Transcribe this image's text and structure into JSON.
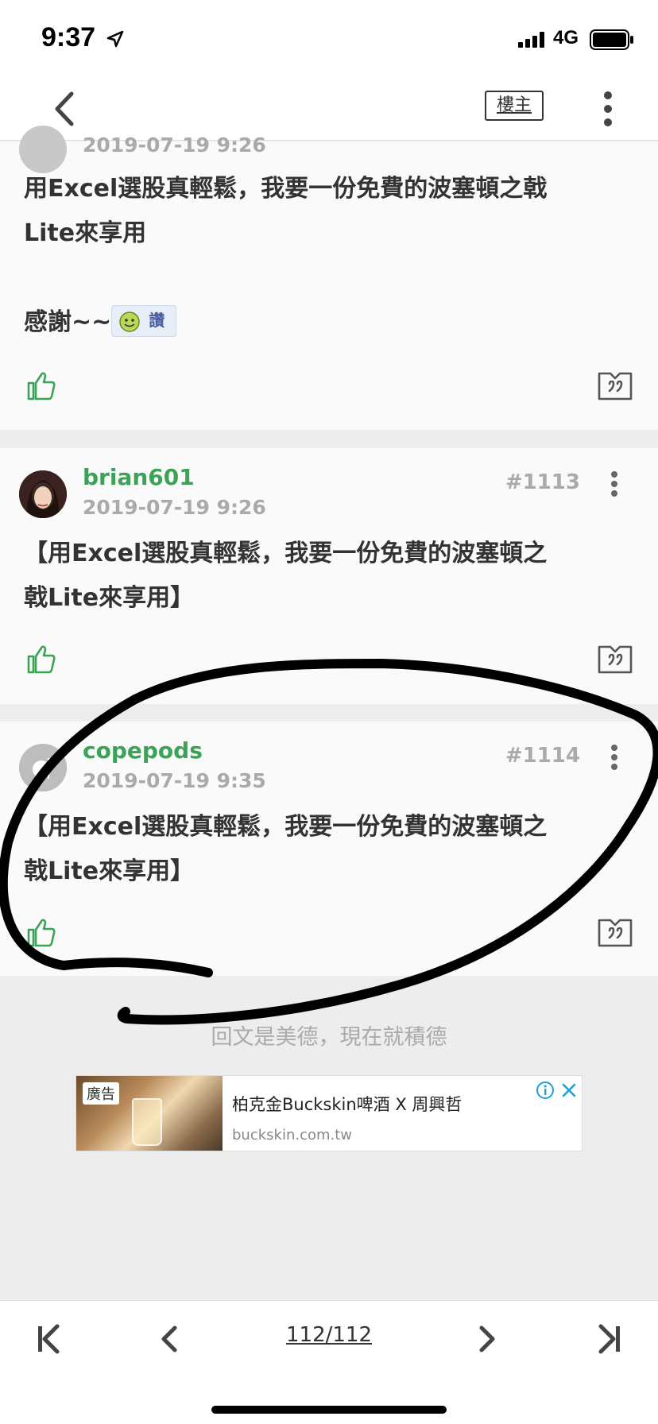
{
  "status_bar": {
    "time": "9:37",
    "network": "4G"
  },
  "nav": {
    "op_label": "樓主"
  },
  "posts": [
    {
      "timestamp": "2019-07-19 9:26",
      "body_line1": "用Excel選股真輕鬆，我要一份免費的波塞頓之戟",
      "body_line2": "Lite來享用",
      "body_line3": "感謝~~",
      "emoticon_text": "讚"
    },
    {
      "author": "brian601",
      "timestamp": "2019-07-19 9:26",
      "floor": "#1113",
      "body_line1": "【用Excel選股真輕鬆，我要一份免費的波塞頓之",
      "body_line2": "戟Lite來享用】"
    },
    {
      "author": "copepods",
      "timestamp": "2019-07-19 9:35",
      "floor": "#1114",
      "body_line1": "【用Excel選股真輕鬆，我要一份免費的波塞頓之",
      "body_line2": "戟Lite來享用】"
    }
  ],
  "reply_hint": "回文是美德，現在就積德",
  "ad": {
    "badge": "廣告",
    "title": "柏克金Buckskin啤酒 X 周興哲",
    "url": "buckskin.com.tw"
  },
  "pager": {
    "label": "112/112"
  },
  "colors": {
    "author_green": "#3aa356",
    "background": "#ededed",
    "card": "#fafafa"
  }
}
